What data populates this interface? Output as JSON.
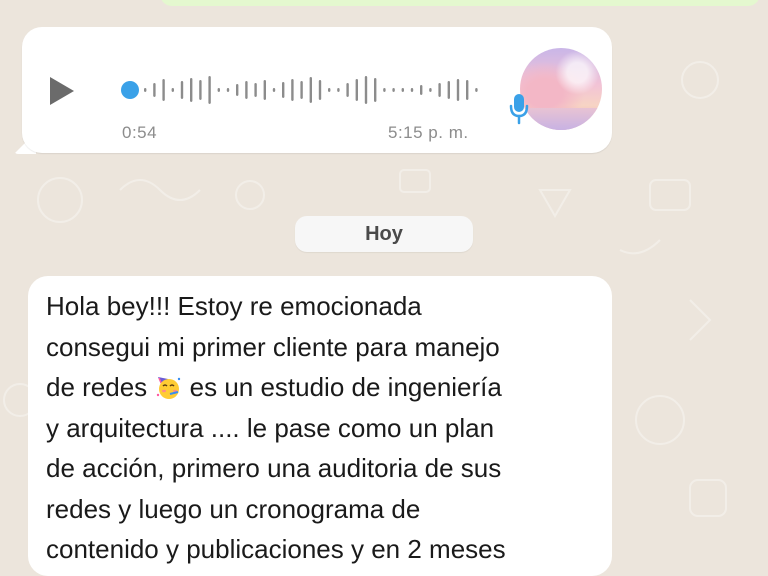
{
  "voice_message": {
    "duration": "0:54",
    "time": "5:15 p. m.",
    "play_icon": "play-icon",
    "mic_icon": "microphone-icon",
    "mic_color": "#3aa1e8",
    "progress_color": "#3aa1e8",
    "progress": 0
  },
  "date_divider": {
    "label": "Hoy"
  },
  "message": {
    "line1": "Hola bey!!! Estoy re emocionada",
    "line2": "consegui mi primer cliente para manejo",
    "line3_before": "de redes ",
    "line3_emoji": "partying-face",
    "line3_after": " es un estudio de ingeniería",
    "line4": "y arquitectura .... le pase como un plan",
    "line5": "de acción, primero una auditoria de sus",
    "line6": "redes y luego un cronograma de",
    "line7": "contenido y publicaciones y en 2 meses"
  },
  "colors": {
    "wallpaper": "#ece5dc",
    "bubble_incoming": "#ffffff",
    "bubble_outgoing": "#e4f8cf",
    "timestamp": "#8c8c8c"
  }
}
